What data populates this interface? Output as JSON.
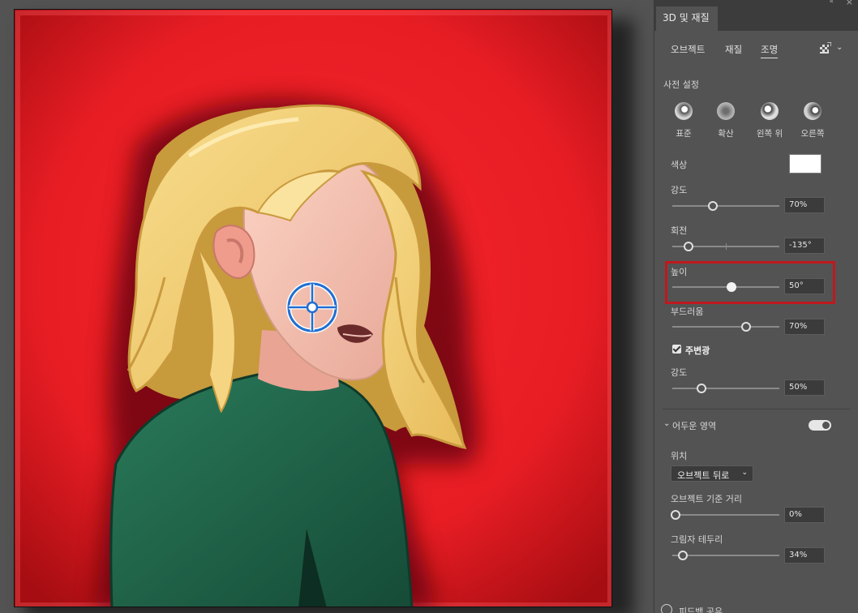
{
  "panel": {
    "collapse_glyph": "«",
    "close_glyph": "×",
    "title": "3D 및 재질",
    "tabs": [
      "오브젝트",
      "재질",
      "조명"
    ],
    "active_tab": "조명",
    "render_icon": "render-icon",
    "chevron_glyph": "⌄"
  },
  "presets": {
    "label": "사전 설정",
    "items": [
      {
        "name": "표준",
        "icon": "standard-light-icon"
      },
      {
        "name": "확산",
        "icon": "diffuse-light-icon"
      },
      {
        "name": "왼쪽 위",
        "icon": "top-left-light-icon"
      },
      {
        "name": "오른쪽",
        "icon": "right-light-icon"
      }
    ]
  },
  "light": {
    "color_label": "색상",
    "color_value": "#FFFFFF",
    "intensity": {
      "label": "강도",
      "value": "70%",
      "fraction": 0.38
    },
    "rotation": {
      "label": "회전",
      "value": "-135°",
      "fraction": 0.15
    },
    "height": {
      "label": "높이",
      "value": "50°",
      "fraction": 0.55
    },
    "softness": {
      "label": "부드러움",
      "value": "70%",
      "fraction": 0.69
    }
  },
  "ambient": {
    "label": "주변광",
    "checked": true,
    "intensity": {
      "label": "강도",
      "value": "50%",
      "fraction": 0.27
    }
  },
  "shadow": {
    "label": "어두운 영역",
    "enabled": true,
    "position_label": "위치",
    "position_value": "오브젝트 뒤로",
    "distance": {
      "label": "오브젝트 기준 거리",
      "value": "0%",
      "fraction": 0.03
    },
    "boundary": {
      "label": "그림자 테두리",
      "value": "34%",
      "fraction": 0.1
    }
  },
  "footer": {
    "label": "피드백 공유"
  },
  "colors": {
    "background_red": "#E41A22",
    "hair": "#F2CE76",
    "skin": "#F7C4B3",
    "sweater": "#1E634A",
    "highlight_box": "#C0181E",
    "light_handle": "#1F6FD1"
  },
  "canvas": {
    "light_handle_icon": "light-position-handle-icon"
  }
}
